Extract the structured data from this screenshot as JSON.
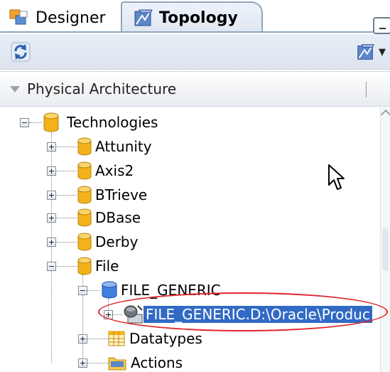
{
  "tabs": [
    {
      "label": "Designer",
      "icon": "designer-icon",
      "active": false
    },
    {
      "label": "Topology",
      "icon": "topology-icon",
      "active": true
    }
  ],
  "toolbar": {
    "refresh_icon": "refresh-icon",
    "topology_menu_icon": "topology-icon"
  },
  "accordion": {
    "title": "Physical Architecture"
  },
  "tree": {
    "root": {
      "label": "Technologies",
      "expanded": true
    },
    "items": [
      {
        "label": "Attunity",
        "expanded": false
      },
      {
        "label": "Axis2",
        "expanded": false
      },
      {
        "label": "BTrieve",
        "expanded": false
      },
      {
        "label": "DBase",
        "expanded": false
      },
      {
        "label": "Derby",
        "expanded": false
      },
      {
        "label": "File",
        "expanded": true
      }
    ],
    "file_children": {
      "server": {
        "label": "FILE_GENERIC",
        "expanded": true
      },
      "schema": {
        "label": "FILE_GENERIC.D:\\Oracle\\Produc",
        "selected": true
      },
      "datatypes": {
        "label": "Datatypes"
      },
      "actions": {
        "label": "Actions"
      }
    }
  },
  "colors": {
    "selection": "#316ac5",
    "annotation_oval": "#e0262b",
    "folder_gold": "#f3b21a"
  }
}
